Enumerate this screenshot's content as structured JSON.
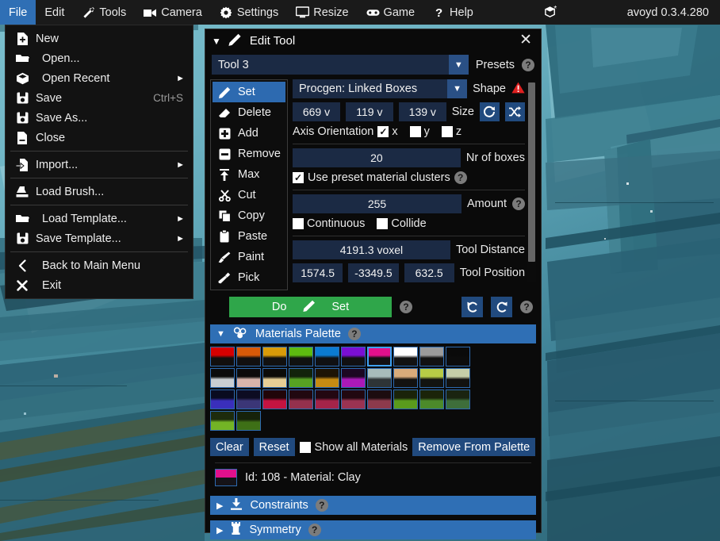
{
  "menubar": {
    "items": [
      {
        "label": "File",
        "icon": "none",
        "active": true
      },
      {
        "label": "Edit",
        "icon": "none",
        "active": false
      },
      {
        "label": "Tools",
        "icon": "wrench-icon",
        "active": false
      },
      {
        "label": "Camera",
        "icon": "camera-icon",
        "active": false
      },
      {
        "label": "Settings",
        "icon": "gear-icon",
        "active": false
      },
      {
        "label": "Resize",
        "icon": "monitor-icon",
        "active": false
      },
      {
        "label": "Game",
        "icon": "gamepad-icon",
        "active": false
      },
      {
        "label": "Help",
        "icon": "question-icon",
        "active": false
      }
    ],
    "status_icon": "cube-modified-icon",
    "version": "avoyd 0.3.4.280"
  },
  "file_menu": {
    "items": [
      {
        "label": "New",
        "icon": "file-new-icon",
        "shortcut": "",
        "submenu": false,
        "indent": false
      },
      {
        "label": "Open...",
        "icon": "folder-open-icon",
        "shortcut": "",
        "submenu": false,
        "indent": true
      },
      {
        "label": "Open Recent",
        "icon": "cube-icon",
        "shortcut": "",
        "submenu": true,
        "indent": true
      },
      {
        "label": "Save",
        "icon": "save-icon",
        "shortcut": "Ctrl+S",
        "submenu": false,
        "indent": false
      },
      {
        "label": "Save As...",
        "icon": "save-icon",
        "shortcut": "",
        "submenu": false,
        "indent": false
      },
      {
        "label": "Close",
        "icon": "file-close-icon",
        "shortcut": "",
        "submenu": false,
        "indent": false
      },
      {
        "separator": true
      },
      {
        "label": "Import...",
        "icon": "import-icon",
        "shortcut": "",
        "submenu": true,
        "indent": false
      },
      {
        "separator": true
      },
      {
        "label": "Load Brush...",
        "icon": "stamp-icon",
        "shortcut": "",
        "submenu": false,
        "indent": false
      },
      {
        "separator": true
      },
      {
        "label": "Load Template...",
        "icon": "folder-open-icon",
        "shortcut": "",
        "submenu": true,
        "indent": true
      },
      {
        "label": "Save Template...",
        "icon": "save-icon",
        "shortcut": "",
        "submenu": true,
        "indent": false
      },
      {
        "separator": true
      },
      {
        "label": "Back to Main Menu",
        "icon": "back-arrow-icon",
        "shortcut": "",
        "submenu": false,
        "indent": true
      },
      {
        "label": "Exit",
        "icon": "close-x-icon",
        "shortcut": "",
        "submenu": false,
        "indent": true
      }
    ]
  },
  "tool_panel": {
    "title": "Edit Tool",
    "title_icon": "pencil-icon",
    "collapse_icon": "triangle-down-icon",
    "close_icon": "close-x-icon",
    "preset": {
      "value": "Tool 3",
      "label": "Presets",
      "help": "?"
    },
    "modes": [
      {
        "label": "Set",
        "icon": "pencil-icon",
        "selected": true
      },
      {
        "label": "Delete",
        "icon": "eraser-icon",
        "selected": false
      },
      {
        "label": "Add",
        "icon": "plus-box-icon",
        "selected": false
      },
      {
        "label": "Remove",
        "icon": "minus-box-icon",
        "selected": false
      },
      {
        "label": "Max",
        "icon": "max-up-icon",
        "selected": false
      },
      {
        "label": "Cut",
        "icon": "scissors-icon",
        "selected": false
      },
      {
        "label": "Copy",
        "icon": "copy-icon",
        "selected": false
      },
      {
        "label": "Paste",
        "icon": "clipboard-icon",
        "selected": false
      },
      {
        "label": "Paint",
        "icon": "brush-icon",
        "selected": false
      },
      {
        "label": "Pick",
        "icon": "eyedropper-icon",
        "selected": false
      }
    ],
    "shape": {
      "value": "Procgen: Linked Boxes",
      "label": "Shape",
      "warning_icon": "warning-triangle-icon"
    },
    "size": {
      "x": "669 v",
      "y": "119 v",
      "z": "139 v",
      "label": "Size",
      "reset_icon": "refresh-icon",
      "random_icon": "shuffle-icon"
    },
    "axis_orientation": {
      "label": "Axis Orientation",
      "axes": [
        {
          "label": "x",
          "checked": true
        },
        {
          "label": "y",
          "checked": false
        },
        {
          "label": "z",
          "checked": false
        }
      ]
    },
    "nr_of_boxes": {
      "value": "20",
      "label": "Nr of boxes"
    },
    "use_preset_material_clusters": {
      "label": "Use preset material clusters",
      "checked": true,
      "help": "?"
    },
    "amount": {
      "value": "255",
      "label": "Amount",
      "help": "?"
    },
    "flags": [
      {
        "label": "Continuous",
        "checked": false
      },
      {
        "label": "Collide",
        "checked": false
      }
    ],
    "tool_distance": {
      "value": "4191.3 voxel",
      "label": "Tool Distance"
    },
    "tool_position": {
      "x": "1574.5",
      "y": "-3349.5",
      "z": "632.5",
      "label": "Tool Position"
    },
    "do_button": {
      "prefix": "Do",
      "icon": "pencil-icon",
      "suffix": "Set",
      "help": "?",
      "color": "#2fa64a"
    },
    "undo_icon": "undo-icon",
    "redo_icon": "redo-icon",
    "history_help": "?"
  },
  "materials_palette": {
    "header": {
      "label": "Materials Palette",
      "icon": "atoms-icon",
      "tri": "triangle-down-icon",
      "help": "?"
    },
    "swatches": [
      {
        "top": "#d60000",
        "bottom": "#120f0e",
        "selected": false
      },
      {
        "top": "#d85a08",
        "bottom": "#121010",
        "selected": false
      },
      {
        "top": "#d99b09",
        "bottom": "#121110",
        "selected": false
      },
      {
        "top": "#5dbb10",
        "bottom": "#101210",
        "selected": false
      },
      {
        "top": "#0b7bd1",
        "bottom": "#101113",
        "selected": false
      },
      {
        "top": "#7a0fd4",
        "bottom": "#111012",
        "selected": false
      },
      {
        "top": "#e2108c",
        "bottom": "#131013",
        "selected": false
      },
      {
        "top": "#ffffff",
        "bottom": "#121212",
        "selected": false
      },
      {
        "top": "#9b9b9b",
        "bottom": "#121212",
        "selected": false
      },
      {
        "top": "#0a0a0a",
        "bottom": "#0c0c0c",
        "selected": false
      },
      {
        "top": "#0b0b0c",
        "bottom": "#c9ced2",
        "selected": false
      },
      {
        "top": "#0c0a0a",
        "bottom": "#d9b5ab",
        "selected": false
      },
      {
        "top": "#0c0b08",
        "bottom": "#e7cf95",
        "selected": false
      },
      {
        "top": "#12230b",
        "bottom": "#57a323",
        "selected": false
      },
      {
        "top": "#1d1405",
        "bottom": "#c58b12",
        "selected": false
      },
      {
        "top": "#1c0722",
        "bottom": "#aa19b8",
        "selected": false
      },
      {
        "top": "#a8bcbb",
        "bottom": "#2e3436",
        "selected": false
      },
      {
        "top": "#d9ab7a",
        "bottom": "#131211",
        "selected": false
      },
      {
        "top": "#b7cc46",
        "bottom": "#121310",
        "selected": false
      },
      {
        "top": "#c6cfa8",
        "bottom": "#121210",
        "selected": false
      },
      {
        "top": "#090b20",
        "bottom": "#3a2fbb",
        "selected": false
      },
      {
        "top": "#0d0c22",
        "bottom": "#3b3677",
        "selected": false
      },
      {
        "top": "#210509",
        "bottom": "#c41441",
        "selected": false
      },
      {
        "top": "#210810",
        "bottom": "#94314d",
        "selected": false
      },
      {
        "top": "#230711",
        "bottom": "#a52449",
        "selected": false
      },
      {
        "top": "#210810",
        "bottom": "#9a3352",
        "selected": false
      },
      {
        "top": "#1c0c10",
        "bottom": "#8c3a4c",
        "selected": false
      },
      {
        "top": "#1a2309",
        "bottom": "#5a9b1c",
        "selected": false
      },
      {
        "top": "#1b2409",
        "bottom": "#4c8a2a",
        "selected": false
      },
      {
        "top": "#1a2410",
        "bottom": "#3e6e3a",
        "selected": false
      },
      {
        "top": "#1d2b0d",
        "bottom": "#73b425",
        "selected": false
      },
      {
        "top": "#16220a",
        "bottom": "#3e7016",
        "selected": false
      }
    ],
    "selected_index": 6,
    "buttons": {
      "clear": "Clear",
      "reset": "Reset",
      "show_all": {
        "label": "Show all Materials",
        "checked": false
      },
      "remove": "Remove From Palette"
    },
    "material_info": {
      "text": "Id: 108 - Material: Clay",
      "swatch_top": "#e2108c",
      "swatch_bottom": "#151318"
    }
  },
  "sections": [
    {
      "label": "Constraints",
      "icon": "download-icon",
      "tri": "triangle-right-icon",
      "help": "?"
    },
    {
      "label": "Symmetry",
      "icon": "tower-icon",
      "tri": "triangle-right-icon",
      "help": "?"
    }
  ]
}
